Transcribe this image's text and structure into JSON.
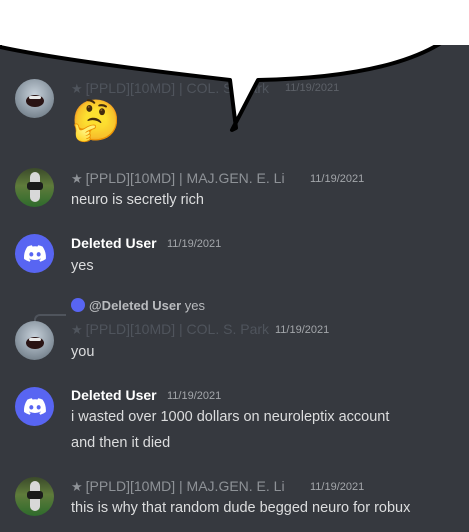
{
  "messages": [
    {
      "id": "m1",
      "author": "[PPLD][10MD] | COL. S. Park",
      "timestamp": "11/19/2021",
      "content_emoji": "🤔"
    },
    {
      "id": "m2",
      "author": "[PPLD][10MD] | MAJ.GEN. E. Li",
      "timestamp": "11/19/2021",
      "content": "neuro is secretly rich"
    },
    {
      "id": "m3",
      "author": "Deleted User",
      "timestamp": "11/19/2021",
      "content": "yes"
    },
    {
      "id": "m4",
      "reply_to_author": "@Deleted User",
      "reply_to_text": "yes",
      "author": "[PPLD][10MD] | COL. S. Park",
      "timestamp": "11/19/2021",
      "content": "you"
    },
    {
      "id": "m5",
      "author": "Deleted User",
      "timestamp": "11/19/2021",
      "content": "i wasted over 1000 dollars on neuroleptix account",
      "content2": "and then it died"
    },
    {
      "id": "m6",
      "author": "[PPLD][10MD] | MAJ.GEN. E. Li",
      "timestamp": "11/19/2021",
      "content": "this is why that random dude begged neuro for robux"
    }
  ],
  "star_glyph": "★",
  "colors": {
    "background": "#36393f",
    "discord_blurple": "#5865f2",
    "text": "#dcddde",
    "muted": "#8e9297"
  }
}
